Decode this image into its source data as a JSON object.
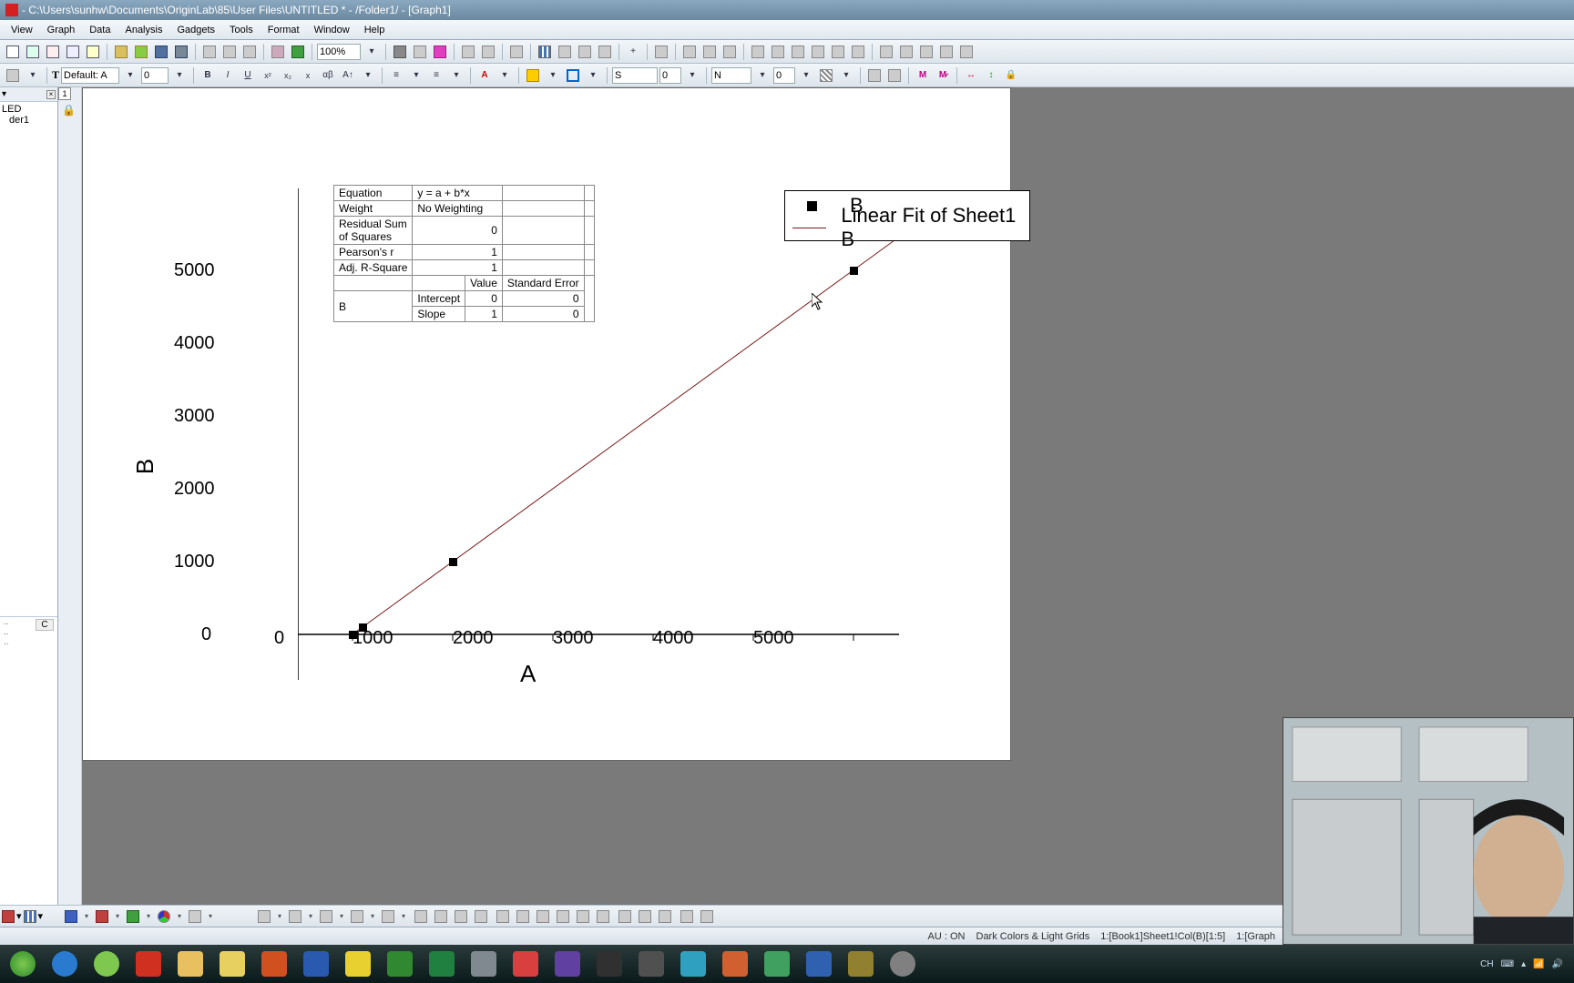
{
  "chart_data": {
    "type": "scatter+line",
    "x": [
      0,
      100,
      1000,
      5000
    ],
    "y": [
      0,
      100,
      1000,
      5000
    ],
    "series": [
      {
        "name": "B",
        "type": "scatter",
        "x": [
          0,
          100,
          1000,
          5000
        ],
        "y": [
          0,
          100,
          1000,
          5000
        ]
      },
      {
        "name": "Linear Fit of Sheet1 B",
        "type": "line",
        "equation": "y = a + b*x",
        "intercept": 0,
        "slope": 1
      }
    ],
    "xlabel": "A",
    "ylabel": "B",
    "xlim": [
      0,
      5500
    ],
    "ylim": [
      0,
      5500
    ],
    "xticks": [
      0,
      1000,
      2000,
      3000,
      4000,
      5000
    ],
    "yticks": [
      0,
      1000,
      2000,
      3000,
      4000,
      5000
    ],
    "fit_results": {
      "Equation": "y = a + b*x",
      "Weight": "No Weighting",
      "Residual Sum of Squares": 0,
      "Pearson's r": 1,
      "Adj. R-Square": 1,
      "Intercept": {
        "Value": 0,
        "Standard Error": 0
      },
      "Slope": {
        "Value": 1,
        "Standard Error": 0
      }
    }
  },
  "title": "- C:\\Users\\sunhw\\Documents\\OriginLab\\85\\User Files\\UNTITLED * - /Folder1/ - [Graph1]",
  "menu": {
    "view": "View",
    "graph": "Graph",
    "data": "Data",
    "analysis": "Analysis",
    "gadgets": "Gadgets",
    "tools": "Tools",
    "format": "Format",
    "window": "Window",
    "help": "Help"
  },
  "zoom": "100%",
  "font_name": "Default: A",
  "font_size": "0",
  "line_style_label": "S",
  "line_w1": "0",
  "edge_label": "N",
  "line_w2": "0",
  "project_explorer": {
    "root": "LED",
    "folder": "der1",
    "colC": "C"
  },
  "tab_number": "1",
  "lock": "🔒",
  "xlabel": "A",
  "ylabel": "B",
  "xticks": {
    "t0": "0",
    "t1": "1000",
    "t2": "2000",
    "t3": "3000",
    "t4": "4000",
    "t5": "5000"
  },
  "yticks": {
    "t0": "0",
    "t1": "1000",
    "t2": "2000",
    "t3": "3000",
    "t4": "4000",
    "t5": "5000"
  },
  "legend": {
    "b": "B",
    "fit": "Linear Fit of Sheet1 B"
  },
  "fit": {
    "eq_label": "Equation",
    "eq_val": "y = a + b*x",
    "w_label": "Weight",
    "w_val": "No Weighting",
    "rss_label": "Residual Sum\nof Squares",
    "rss_val": "0",
    "r_label": "Pearson's r",
    "r_val": "1",
    "ars_label": "Adj. R-Square",
    "ars_val": "1",
    "val_hdr": "Value",
    "se_hdr": "Standard Error",
    "b_label": "B",
    "int_label": "Intercept",
    "int_val": "0",
    "int_se": "0",
    "slope_label": "Slope",
    "slope_val": "1",
    "slope_se": "0"
  },
  "status": {
    "au": "AU : ON",
    "theme": "Dark Colors & Light Grids",
    "range": "1:[Book1]Sheet1!Col(B)[1:5]",
    "graph": "1:[Graph"
  },
  "tray": {
    "ime": "CH",
    "kb": "⌨"
  }
}
